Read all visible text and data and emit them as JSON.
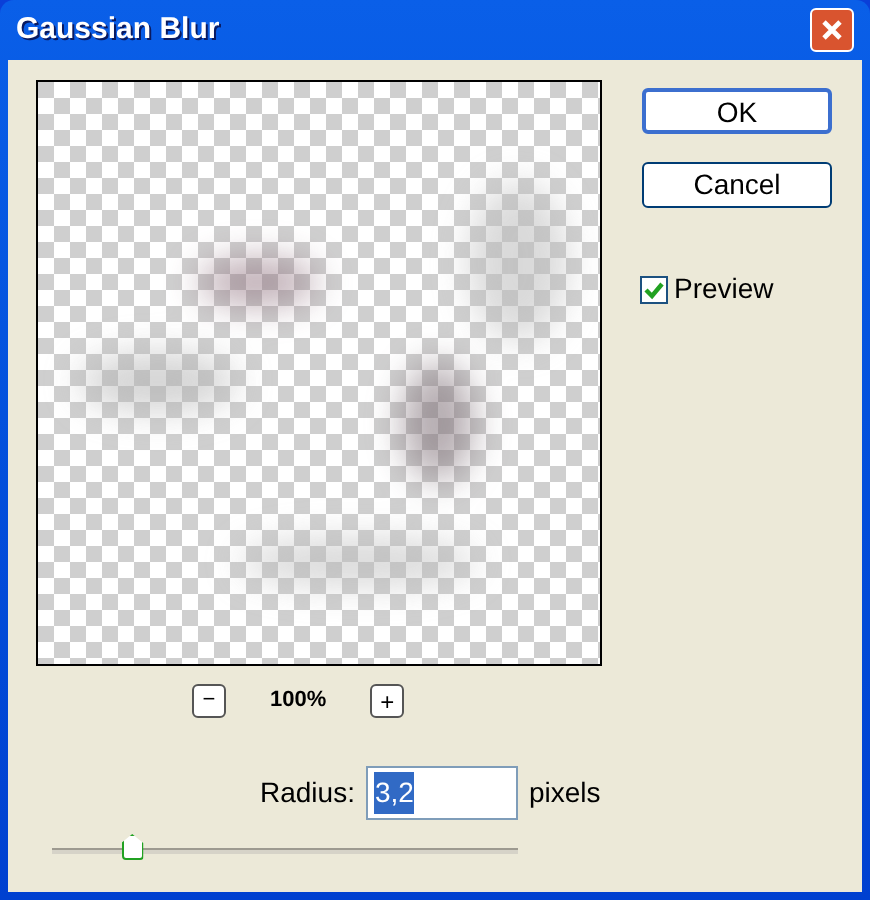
{
  "window": {
    "title": "Gaussian Blur"
  },
  "zoom": {
    "out_label": "−",
    "level": "100%",
    "in_label": "+"
  },
  "buttons": [
    {
      "label": "OK",
      "default": true
    },
    {
      "label": "Cancel",
      "default": false
    }
  ],
  "preview_checkbox": {
    "label": "Preview",
    "checked": true
  },
  "radius": {
    "label": "Radius:",
    "value": "3,2",
    "unit": "pixels",
    "level": 0.17
  }
}
